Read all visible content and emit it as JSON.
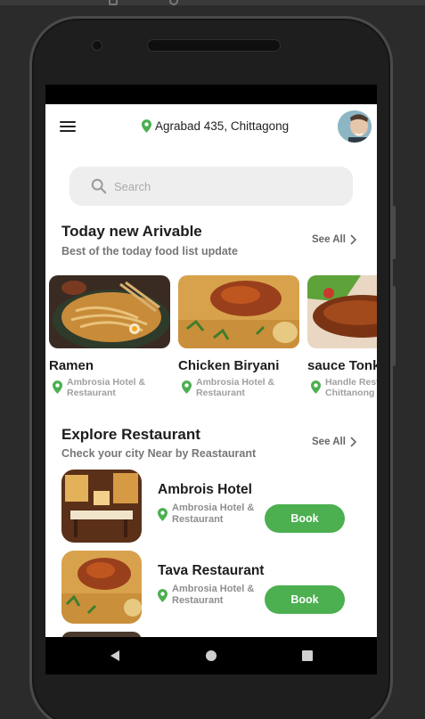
{
  "header": {
    "location": "Agrabad 435, Chittagong"
  },
  "search": {
    "placeholder": "Search"
  },
  "today_section": {
    "title": "Today new Arivable",
    "subtitle": "Best of the today food list update",
    "see_all": "See All",
    "items": [
      {
        "name": "Ramen",
        "address": "Ambrosia Hotel & Restaurant",
        "address_lines": [
          "Ambrosia Hotel &",
          "Restaurant"
        ]
      },
      {
        "name": "Chicken Biryani",
        "address": "Ambrosia Hotel & Restaurant",
        "address_lines": [
          "Ambrosia Hotel &",
          "Restaurant"
        ]
      },
      {
        "name": "sauce Tonk",
        "address": "Handle Rest Chittanong",
        "address_lines": [
          "Handle Rest",
          "Chittanong"
        ]
      }
    ]
  },
  "explore_section": {
    "title": "Explore Restaurant",
    "subtitle": "Check your city Near by Reastaurant",
    "see_all": "See All",
    "restaurants": [
      {
        "name": "Ambrois Hotel",
        "address": "Ambrosia Hotel & Restaurant",
        "book_label": "Book"
      },
      {
        "name": "Tava Restaurant",
        "address": "Ambrosia Hotel & Restaurant",
        "book_label": "Book"
      }
    ]
  },
  "colors": {
    "accent": "#4caf50",
    "search_bg": "#eeeeee"
  },
  "icons": {
    "menu": "hamburger-menu-icon",
    "location": "location-pin-icon",
    "search": "search-icon",
    "see_all": "chevron-right-icon",
    "nav_back": "triangle-back-icon",
    "nav_home": "circle-home-icon",
    "nav_recent": "square-recent-apps-icon"
  }
}
